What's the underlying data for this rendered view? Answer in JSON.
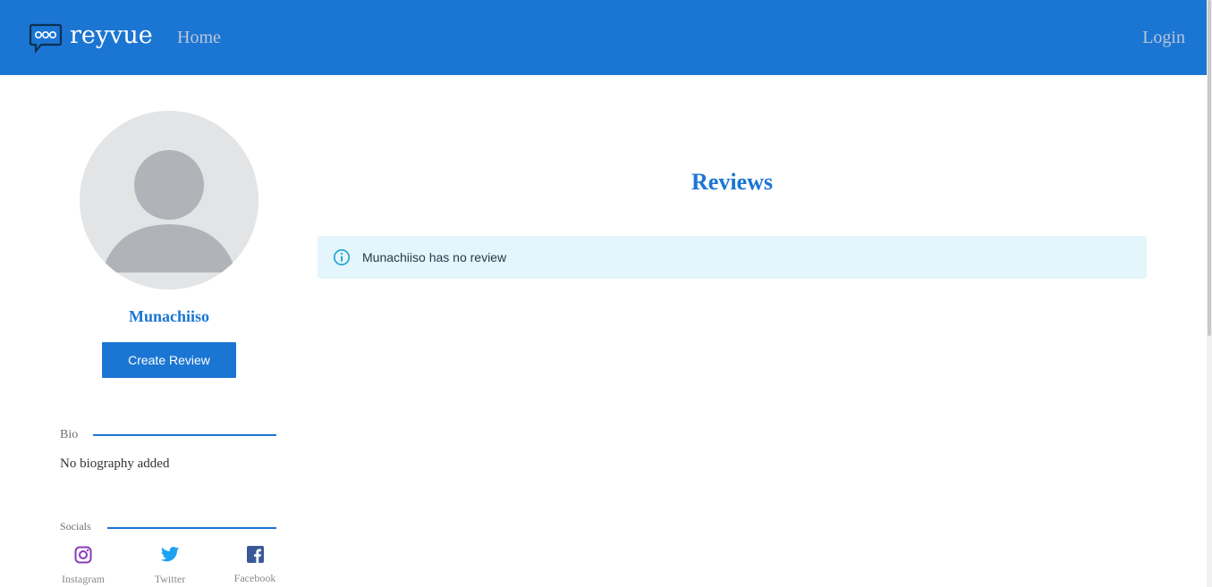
{
  "header": {
    "brand": "reyvue",
    "nav_home": "Home",
    "nav_login": "Login"
  },
  "profile": {
    "username": "Munachiiso",
    "create_review_label": "Create Review"
  },
  "bio": {
    "heading": "Bio",
    "text": "No biography added"
  },
  "socials": {
    "heading": "Socials",
    "items": [
      {
        "label": "Instagram",
        "icon": "instagram-icon",
        "color": "#8a3ab9"
      },
      {
        "label": "Twitter",
        "icon": "twitter-icon",
        "color": "#1da1f2"
      },
      {
        "label": "Facebook",
        "icon": "facebook-icon",
        "color": "#3b5998"
      }
    ]
  },
  "reviews": {
    "title": "Reviews",
    "empty_message": "Munachiiso has no review"
  },
  "colors": {
    "brand": "#1b75d3",
    "alert_bg": "#e4f5fb",
    "alert_icon": "#17a2d3"
  }
}
